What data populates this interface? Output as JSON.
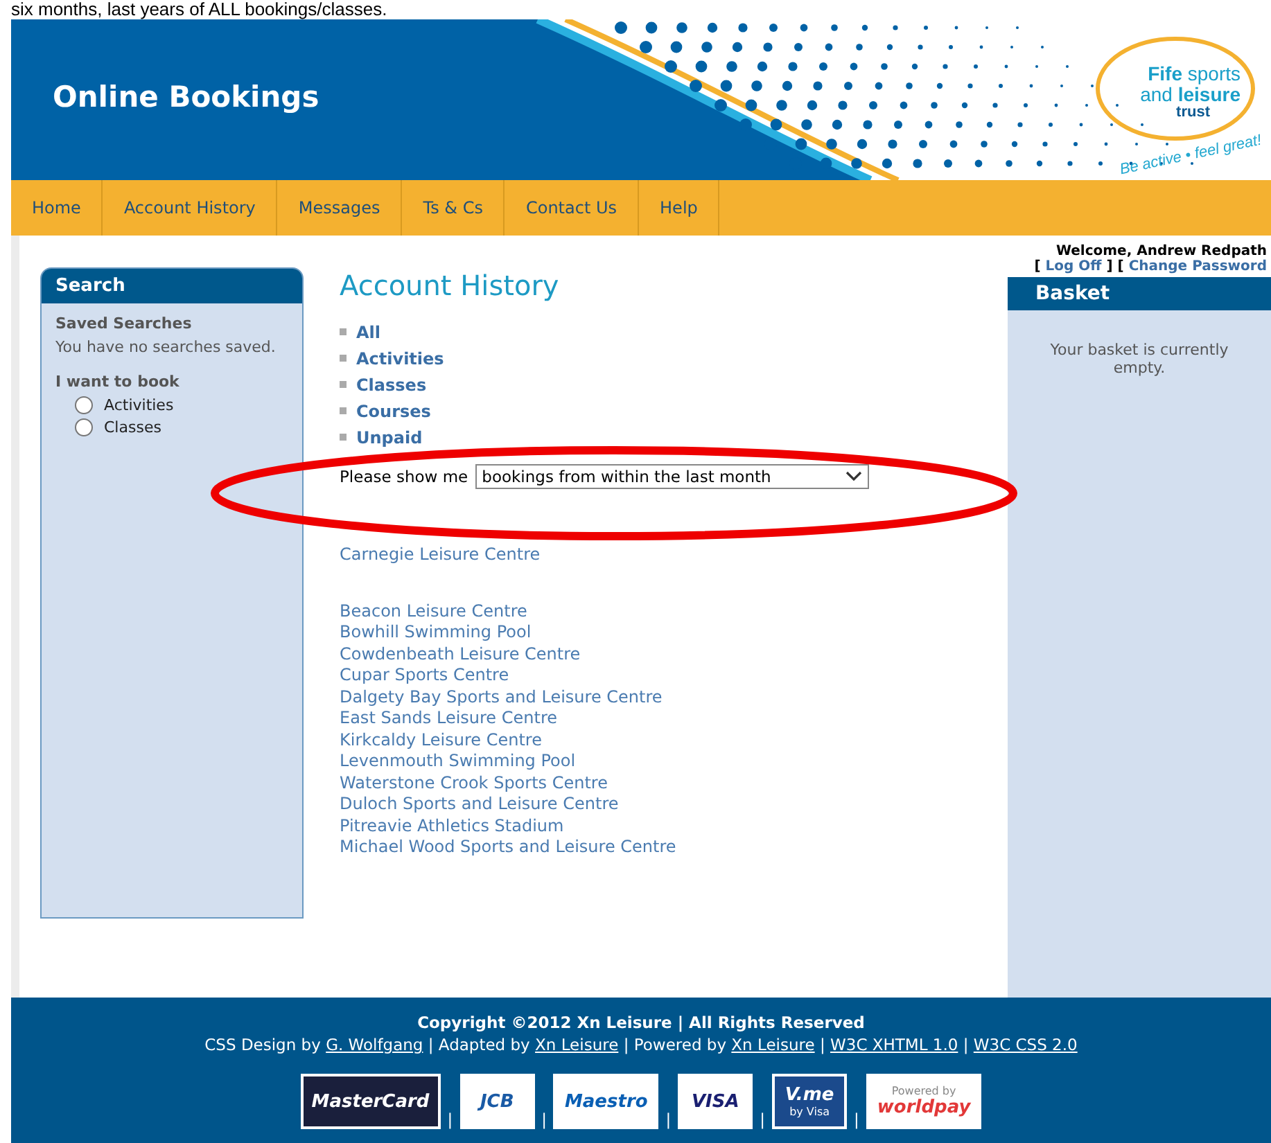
{
  "caption": "six months, last years of ALL bookings/classes.",
  "header": {
    "title": "Online Bookings",
    "logo": {
      "line_1": "**Fife** sports",
      "line_2": "and **leisure**",
      "line_3": "trust",
      "tagline": "Be active • feel great!"
    }
  },
  "nav": [
    "Home",
    "Account History",
    "Messages",
    "Ts & Cs",
    "Contact Us",
    "Help"
  ],
  "search_panel": {
    "title": "Search",
    "saved_heading": "Saved Searches",
    "saved_text": "You have no searches saved.",
    "book_heading": "I want to book",
    "options": [
      {
        "label": "Activities",
        "checked": false
      },
      {
        "label": "Classes",
        "checked": false
      }
    ]
  },
  "content": {
    "title": "Account History",
    "filters": [
      "All",
      "Activities",
      "Classes",
      "Courses",
      "Unpaid"
    ],
    "show_label": "Please show me",
    "show_value": "bookings from within the last month",
    "first_venues": [
      "Carnegie Leisure Centre"
    ],
    "venues": [
      "Beacon Leisure Centre",
      "Bowhill Swimming Pool",
      "Cowdenbeath Leisure Centre",
      "Cupar Sports Centre",
      "Dalgety Bay Sports and Leisure Centre",
      "East Sands Leisure Centre",
      "Kirkcaldy Leisure Centre",
      "Levenmouth Swimming Pool",
      "Waterstone Crook Sports Centre",
      "Duloch Sports and Leisure Centre",
      "Pitreavie Athletics Stadium",
      "Michael Wood Sports and Leisure Centre"
    ]
  },
  "account": {
    "welcome": "Welcome, Andrew Redpath",
    "open_bracket": "[",
    "log_off": "Log Off",
    "middle_bracket": "] [",
    "change_password": "Change Password"
  },
  "basket": {
    "title": "Basket",
    "text": "Your basket is currently empty."
  },
  "footer": {
    "copyright": "Copyright ©2012 Xn Leisure | All Rights Reserved",
    "credits": [
      {
        "kind": "text",
        "text": "CSS Design by"
      },
      {
        "kind": "link",
        "text": "G. Wolfgang"
      },
      {
        "kind": "text",
        "text": "| Adapted by"
      },
      {
        "kind": "link",
        "text": "Xn Leisure"
      },
      {
        "kind": "text",
        "text": "| Powered by"
      },
      {
        "kind": "link",
        "text": "Xn Leisure"
      },
      {
        "kind": "text",
        "text": "|"
      },
      {
        "kind": "link",
        "text": "W3C XHTML 1.0"
      },
      {
        "kind": "text",
        "text": "|"
      },
      {
        "kind": "link",
        "text": "W3C CSS 2.0"
      }
    ],
    "separator": "|",
    "cards": [
      {
        "kind": "mastercard",
        "text": "MasterCard"
      },
      {
        "kind": "jcb",
        "text": "JCB"
      },
      {
        "kind": "maestro",
        "text": "Maestro"
      },
      {
        "kind": "visa",
        "text": "VISA"
      },
      {
        "kind": "vme",
        "text": "V.me",
        "sub": "by Visa"
      },
      {
        "kind": "worldpay",
        "text": "worldpay",
        "sub": "Powered by"
      }
    ]
  }
}
